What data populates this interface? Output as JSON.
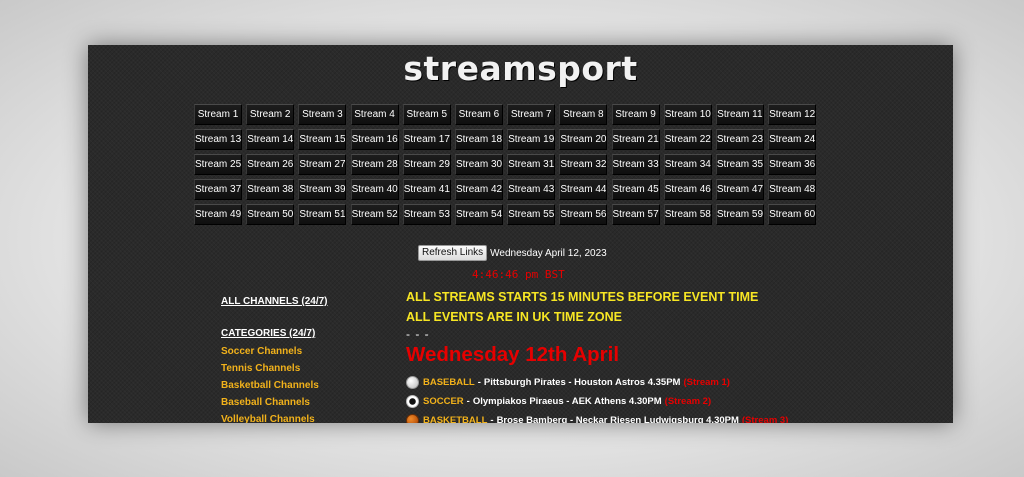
{
  "site": {
    "logo": "streamsport"
  },
  "streams": [
    "Stream 1",
    "Stream 2",
    "Stream 3",
    "Stream 4",
    "Stream 5",
    "Stream 6",
    "Stream 7",
    "Stream 8",
    "Stream 9",
    "Stream 10",
    "Stream 11",
    "Stream 12",
    "Stream 13",
    "Stream 14",
    "Stream 15",
    "Stream 16",
    "Stream 17",
    "Stream 18",
    "Stream 19",
    "Stream 20",
    "Stream 21",
    "Stream 22",
    "Stream 23",
    "Stream 24",
    "Stream 25",
    "Stream 26",
    "Stream 27",
    "Stream 28",
    "Stream 29",
    "Stream 30",
    "Stream 31",
    "Stream 32",
    "Stream 33",
    "Stream 34",
    "Stream 35",
    "Stream 36",
    "Stream 37",
    "Stream 38",
    "Stream 39",
    "Stream 40",
    "Stream 41",
    "Stream 42",
    "Stream 43",
    "Stream 44",
    "Stream 45",
    "Stream 46",
    "Stream 47",
    "Stream 48",
    "Stream 49",
    "Stream 50",
    "Stream 51",
    "Stream 52",
    "Stream 53",
    "Stream 54",
    "Stream 55",
    "Stream 56",
    "Stream 57",
    "Stream 58",
    "Stream 59",
    "Stream 60"
  ],
  "toolbar": {
    "refresh_label": "Refresh Links",
    "date": "Wednesday April 12, 2023",
    "clock": "4:46:46 pm BST"
  },
  "sidebar": {
    "all_channels": "ALL CHANNELS (24/7)",
    "categories": "CATEGORIES (24/7)",
    "links": [
      "Soccer Channels",
      "Tennis Channels",
      "Basketball Channels",
      "Baseball Channels",
      "Volleyball Channels"
    ]
  },
  "main": {
    "notice1": "ALL STREAMS STARTS 15 MINUTES BEFORE EVENT TIME",
    "notice2": "ALL EVENTS ARE IN UK TIME ZONE",
    "dashes": "- - -",
    "day_heading": "Wednesday 12th April",
    "events": [
      {
        "icon": "baseball-icon",
        "sport": "BASEBALL",
        "match": "Pittsburgh Pirates - Houston Astros 4.35PM",
        "link": "(Stream 1)"
      },
      {
        "icon": "soccer-ball-icon",
        "sport": "SOCCER",
        "match": "Olympiakos Piraeus - AEK Athens 4.30PM",
        "link": "(Stream 2)"
      },
      {
        "icon": "basketball-icon",
        "sport": "BASKETBALL",
        "match": "Brose Bamberg - Neckar Riesen Ludwigsburg 4.30PM",
        "link": "(Stream 3)"
      }
    ]
  },
  "colors": {
    "background": "#2a2a2a",
    "accent_yellow": "#f7e624",
    "accent_orange": "#f2b21b",
    "accent_red": "#e60000"
  }
}
